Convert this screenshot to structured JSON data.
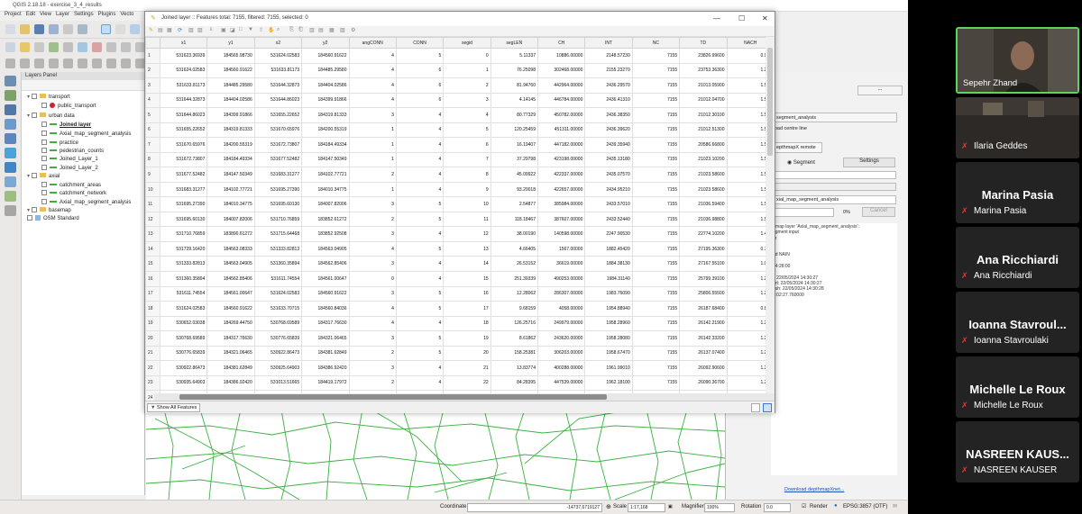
{
  "qgis": {
    "title": "QGIS 2.18.18 - exercise_3_4_results",
    "menu": [
      "Project",
      "Edit",
      "View",
      "Layer",
      "Settings",
      "Plugins",
      "Vecto"
    ],
    "layers_panel_title": "Layers Panel",
    "layers": [
      {
        "name": "transport",
        "indent": 0,
        "type": "group"
      },
      {
        "name": "public_transport",
        "indent": 1,
        "type": "point"
      },
      {
        "name": "urban data",
        "indent": 0,
        "type": "group"
      },
      {
        "name": "Joined layer",
        "indent": 1,
        "type": "line"
      },
      {
        "name": "Axial_map_segment_analysis",
        "indent": 1,
        "type": "line"
      },
      {
        "name": "practice",
        "indent": 1,
        "type": "line"
      },
      {
        "name": "pedestrian_counts",
        "indent": 1,
        "type": "line"
      },
      {
        "name": "Joined_Layer_1",
        "indent": 1,
        "type": "line"
      },
      {
        "name": "Joined_Layer_2",
        "indent": 1,
        "type": "line"
      },
      {
        "name": "axial",
        "indent": 0,
        "type": "group"
      },
      {
        "name": "catchment_areas",
        "indent": 1,
        "type": "line"
      },
      {
        "name": "catchment_network",
        "indent": 1,
        "type": "line"
      },
      {
        "name": "Axial_map_segment_analysis",
        "indent": 1,
        "type": "line"
      },
      {
        "name": "basemap",
        "indent": 0,
        "type": "group"
      },
      {
        "name": "OSM Standard",
        "indent": 0,
        "type": "raster"
      }
    ],
    "status": {
      "coordinate_label": "Coordinate",
      "coordinate": "-14737,6719127",
      "scale_label": "Scale",
      "scale": "1:17,168",
      "magnifier_label": "Magnifier",
      "magnifier": "100%",
      "rotation_label": "Rotation",
      "rotation": "0.0",
      "render_label": "Render",
      "epsg": "EPSG:3857 (OTF)"
    },
    "right_panel": {
      "dropdown_value": "segment_analysis",
      "road_centre_line": "road centre line",
      "tab": "epthmapX remote",
      "radio": "Segment",
      "settings_button": "Settings",
      "layer_field": "xial_map_segment_analysis",
      "progress": "0%",
      "cancel_button": "Cancel",
      "log": "r map layer 'Axial_map_segment_analysis':\negment input\nar\n\n\nnd NAIN\n\n14:28:00\n\nt: 22/05/2024 14:30:27\nart: 22/05/2024 14:30:27\nrish: 22/05/2024 14:30:28\n0:02:27.760000",
      "link": "Download depthmapXnet..."
    }
  },
  "attribute_table": {
    "title": "Joined layer :: Features total: 7155, filtered: 7155, selected: 0",
    "columns": [
      "x1",
      "y1",
      "x2",
      "y2",
      "angCONN",
      "CONN",
      "segid",
      "segLEN",
      "CH",
      "INT",
      "NC",
      "TD",
      "NACH"
    ],
    "rows": [
      [
        "1",
        "531623.36939",
        "184565.98730",
        "531624.02583",
        "184560.91622",
        "4",
        "5",
        "0",
        "5.11337",
        "10886.00000",
        "2148.57230",
        "7155",
        "23826.99600",
        "0.922"
      ],
      [
        "2",
        "531624.02583",
        "184560.91622",
        "531633.81173",
        "184485.29580",
        "4",
        "6",
        "1",
        "76.25098",
        "302468.00000",
        "2155.23270",
        "7155",
        "23753.36300",
        "1.252"
      ],
      [
        "3",
        "531633.81173",
        "184485.29580",
        "531644.32873",
        "184404.02586",
        "4",
        "6",
        "2",
        "81.94760",
        "442964.00000",
        "2436.29570",
        "7155",
        "21013.05900",
        "1.537"
      ],
      [
        "4",
        "531644.32873",
        "184404.02586",
        "531644.86023",
        "184399.91866",
        "4",
        "6",
        "3",
        "4.14145",
        "446784.00000",
        "2436.41310",
        "7155",
        "21012.04700",
        "1.538"
      ],
      [
        "5",
        "531644.86023",
        "184399.91866",
        "531655.22652",
        "184319.81333",
        "3",
        "4",
        "4",
        "80.77329",
        "450782.00000",
        "2436.38350",
        "7155",
        "21012.30100",
        "1.539"
      ],
      [
        "6",
        "531655.22652",
        "184319.81333",
        "531670.65976",
        "184200.55319",
        "1",
        "4",
        "5",
        "120.25459",
        "451311.00000",
        "2436.39620",
        "7155",
        "21012.51300",
        "1.539"
      ],
      [
        "7",
        "531670.65976",
        "184200.55319",
        "531672.73807",
        "184184.49334",
        "1",
        "4",
        "6",
        "16.19407",
        "447182.00000",
        "2439.35940",
        "7155",
        "20586.66800",
        "1.538"
      ],
      [
        "8",
        "531672.73807",
        "184184.49334",
        "531677.52482",
        "184147.50349",
        "1",
        "4",
        "7",
        "37.29798",
        "423198.00000",
        "2435.13180",
        "7155",
        "21023.10200",
        "1.532"
      ],
      [
        "9",
        "531677.52482",
        "184147.50349",
        "531683.31277",
        "184102.77721",
        "2",
        "4",
        "8",
        "45.09922",
        "422337.00000",
        "2435.07570",
        "7155",
        "21023.58600",
        "1.532"
      ],
      [
        "10",
        "531683.31277",
        "184102.77721",
        "531695.27390",
        "184010.34775",
        "1",
        "4",
        "9",
        "93.20018",
        "422657.00000",
        "2434.95210",
        "7155",
        "21023.58600",
        "1.532"
      ],
      [
        "11",
        "531695.27390",
        "184010.34775",
        "531695.60130",
        "184007.82006",
        "3",
        "5",
        "10",
        "2.54877",
        "385984.00000",
        "2433.57010",
        "7155",
        "21036.59400",
        "1.523"
      ],
      [
        "12",
        "531695.60130",
        "184007.82006",
        "531710.76859",
        "183852.61272",
        "2",
        "5",
        "11",
        "118.18467",
        "387607.00000",
        "2433.52440",
        "7155",
        "21036.98800",
        "1.524"
      ],
      [
        "13",
        "531710.76859",
        "183890.61272",
        "531715.64468",
        "183852.92508",
        "3",
        "4",
        "12",
        "38.00190",
        "140598.00000",
        "2247.90530",
        "7155",
        "22774.10200",
        "1.410"
      ],
      [
        "14",
        "531729.16420",
        "184563.08333",
        "531333.82813",
        "184563.04905",
        "4",
        "5",
        "13",
        "4.66405",
        "1567.00000",
        "1882.45420",
        "7155",
        "27195.36300",
        "0.720"
      ],
      [
        "15",
        "531333.82813",
        "184563.04905",
        "531360.35894",
        "184562.85406",
        "3",
        "4",
        "14",
        "26.53152",
        "36619.00000",
        "1884.38130",
        "7155",
        "27167.55100",
        "1.029"
      ],
      [
        "16",
        "531360.35894",
        "184562.85406",
        "531611.74554",
        "184561.00647",
        "0",
        "4",
        "15",
        "251.39339",
        "490253.00000",
        "1984.31140",
        "7155",
        "25799.39100",
        "1.289"
      ],
      [
        "17",
        "531611.74554",
        "184561.00647",
        "531624.02583",
        "184560.91622",
        "3",
        "5",
        "16",
        "12.28062",
        "286307.00000",
        "1983.76090",
        "7155",
        "25806.55500",
        "1.236"
      ],
      [
        "18",
        "531624.02583",
        "184560.91622",
        "531633.70715",
        "184560.84036",
        "4",
        "5",
        "17",
        "9.68159",
        "4058.00000",
        "1954.88940",
        "7155",
        "26187.68400",
        "0.817"
      ],
      [
        "19",
        "530652.03038",
        "184269.44750",
        "530768.69589",
        "184317.76630",
        "4",
        "4",
        "18",
        "126.25716",
        "249979.00000",
        "1958.28960",
        "7155",
        "26142.21900",
        "1.221"
      ],
      [
        "20",
        "530768.69589",
        "184317.76630",
        "530776.65839",
        "184321.06465",
        "3",
        "5",
        "19",
        "8.61862",
        "243620.00000",
        "1958.28080",
        "7155",
        "26142.33200",
        "1.219"
      ],
      [
        "21",
        "530776.65839",
        "184321.06465",
        "530922.86473",
        "184381.62849",
        "2",
        "5",
        "20",
        "158.25381",
        "306203.00000",
        "1958.67470",
        "7155",
        "26137.07400",
        "1.241"
      ],
      [
        "22",
        "530922.86473",
        "184381.62849",
        "530925.64903",
        "184386.92420",
        "3",
        "4",
        "21",
        "13.83774",
        "400288.00000",
        "1961.99010",
        "7155",
        "26092.90600",
        "1.268"
      ],
      [
        "23",
        "530935.64903",
        "184386.92420",
        "531013.51665",
        "184419.17972",
        "2",
        "4",
        "22",
        "84.28395",
        "447539.00000",
        "1962.18100",
        "7155",
        "26090.36700",
        "1.279"
      ],
      [
        "24",
        "531013.51665",
        "184419.17972",
        "531067.57386",
        "184441.57205",
        "2",
        "4",
        "23",
        "58.51134",
        "454114.00000",
        "1962.18100",
        "7155",
        "26090.26600",
        "1.280"
      ]
    ],
    "show_all": "Show All Features"
  },
  "participants": [
    {
      "label": "Sepehr Zhand",
      "big": "",
      "video": true
    },
    {
      "label": "Ilaria Geddes",
      "big": "",
      "video": true
    },
    {
      "label": "Marina Pasia",
      "big": "Marina Pasia",
      "video": false
    },
    {
      "label": "Ana Ricchiardi",
      "big": "Ana Ricchiardi",
      "video": false
    },
    {
      "label": "Ioanna Stavroulaki",
      "big": "Ioanna Stavroul...",
      "video": false
    },
    {
      "label": "Michelle Le Roux",
      "big": "Michelle Le Roux",
      "video": false
    },
    {
      "label": "NASREEN KAUSER",
      "big": "NASREEN KAUS...",
      "video": false
    }
  ],
  "colors": {
    "active_speaker": "#5fd35a",
    "muted": "#e53935",
    "map_lines": "#3cb043"
  }
}
